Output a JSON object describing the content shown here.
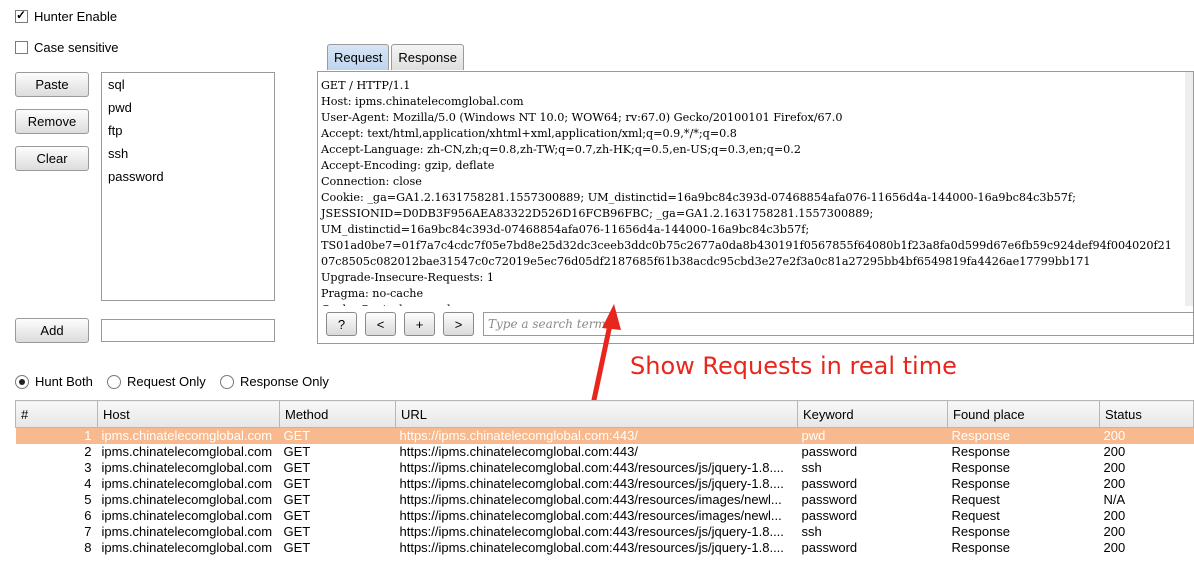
{
  "options": {
    "hunter_enable": "Hunter Enable",
    "case_sensitive": "Case sensitive"
  },
  "buttons": {
    "paste": "Paste",
    "remove": "Remove",
    "clear": "Clear",
    "add": "Add"
  },
  "keywords": [
    "sql",
    "pwd",
    "ftp",
    "ssh",
    "password"
  ],
  "tabs": {
    "request": "Request",
    "response": "Response"
  },
  "request_text": [
    "GET / HTTP/1.1",
    "Host: ipms.chinatelecomglobal.com",
    "User-Agent: Mozilla/5.0 (Windows NT 10.0; WOW64; rv:67.0) Gecko/20100101 Firefox/67.0",
    "Accept: text/html,application/xhtml+xml,application/xml;q=0.9,*/*;q=0.8",
    "Accept-Language: zh-CN,zh;q=0.8,zh-TW;q=0.7,zh-HK;q=0.5,en-US;q=0.3,en;q=0.2",
    "Accept-Encoding: gzip, deflate",
    "Connection: close",
    "Cookie: _ga=GA1.2.1631758281.1557300889; UM_distinctid=16a9bc84c393d-07468854afa076-11656d4a-144000-16a9bc84c3b57f;",
    "JSESSIONID=D0DB3F956AEA83322D526D16FCB96FBC; _ga=GA1.2.1631758281.1557300889;",
    "UM_distinctid=16a9bc84c393d-07468854afa076-11656d4a-144000-16a9bc84c3b57f;",
    "TS01ad0be7=01f7a7c4cdc7f05e7bd8e25d32dc3ceeb3ddc0b75c2677a0da8b430191f0567855f64080b1f23a8fa0d599d67e6fb59c924def94f004020f21",
    "07c8505c082012bae31547c0c72019e5ec76d05df2187685f61b38acdc95cbd3e27e2f3a0c81a27295bb4bf6549819fa4426ae17799bb171",
    "Upgrade-Insecure-Requests: 1",
    "Pragma: no-cache",
    "Cache-Control: no-cache"
  ],
  "toolbar": {
    "help": "?",
    "prev": "<",
    "add": "+",
    "next": ">",
    "search_placeholder": "Type a search term"
  },
  "hunt_mode": {
    "both": "Hunt Both",
    "request_only": "Request Only",
    "response_only": "Response Only"
  },
  "annotation": "Show Requests in real time",
  "annotation_color": "#e8261d",
  "table": {
    "columns": [
      "#",
      "Host",
      "Method",
      "URL",
      "Keyword",
      "Found place",
      "Status"
    ],
    "rows": [
      [
        "1",
        "ipms.chinatelecomglobal.com",
        "GET",
        "https://ipms.chinatelecomglobal.com:443/",
        "pwd",
        "Response",
        "200"
      ],
      [
        "2",
        "ipms.chinatelecomglobal.com",
        "GET",
        "https://ipms.chinatelecomglobal.com:443/",
        "password",
        "Response",
        "200"
      ],
      [
        "3",
        "ipms.chinatelecomglobal.com",
        "GET",
        "https://ipms.chinatelecomglobal.com:443/resources/js/jquery-1.8....",
        "ssh",
        "Response",
        "200"
      ],
      [
        "4",
        "ipms.chinatelecomglobal.com",
        "GET",
        "https://ipms.chinatelecomglobal.com:443/resources/js/jquery-1.8....",
        "password",
        "Response",
        "200"
      ],
      [
        "5",
        "ipms.chinatelecomglobal.com",
        "GET",
        "https://ipms.chinatelecomglobal.com:443/resources/images/newl...",
        "password",
        "Request",
        "N/A"
      ],
      [
        "6",
        "ipms.chinatelecomglobal.com",
        "GET",
        "https://ipms.chinatelecomglobal.com:443/resources/images/newl...",
        "password",
        "Request",
        "200"
      ],
      [
        "7",
        "ipms.chinatelecomglobal.com",
        "GET",
        "https://ipms.chinatelecomglobal.com:443/resources/js/jquery-1.8....",
        "ssh",
        "Response",
        "200"
      ],
      [
        "8",
        "ipms.chinatelecomglobal.com",
        "GET",
        "https://ipms.chinatelecomglobal.com:443/resources/js/jquery-1.8....",
        "password",
        "Response",
        "200"
      ]
    ],
    "selected_row_color": "#f7b98d"
  }
}
